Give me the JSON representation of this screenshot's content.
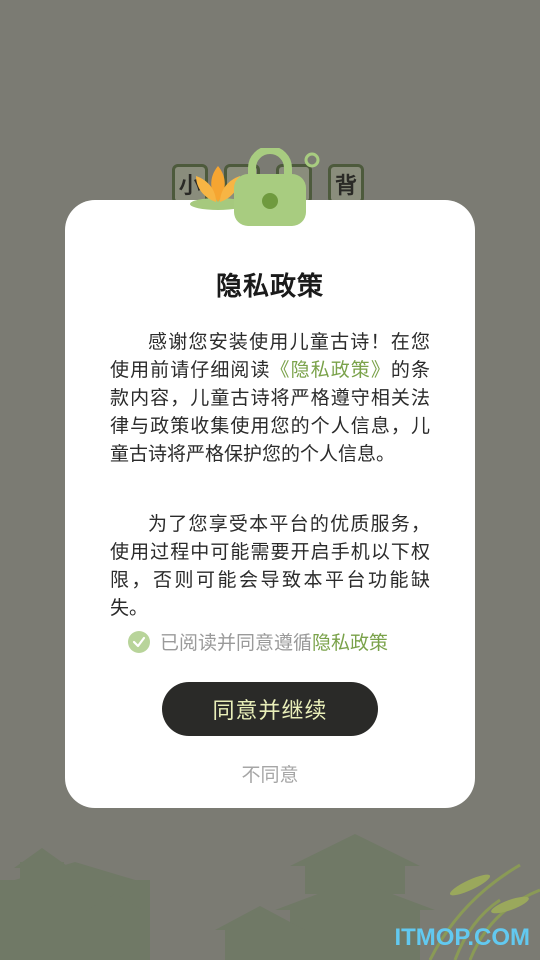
{
  "background": {
    "tiles": [
      "小",
      "背"
    ]
  },
  "dialog": {
    "title": "隐私政策",
    "paragraph1_before": "感谢您安装使用儿童古诗！在您使用前请仔细阅读",
    "paragraph1_link": "《隐私政策》",
    "paragraph1_after": "的条款内容，儿童古诗将严格遵守相关法律与政策收集使用您的个人信息，儿童古诗将严格保护您的个人信息。",
    "paragraph2": "为了您享受本平台的优质服务，使用过程中可能需要开启手机以下权限，否则可能会导致本平台功能缺失。",
    "consent_text": "已阅读并同意遵循",
    "consent_link": "隐私政策",
    "agree_label": "同意并继续",
    "disagree_label": "不同意"
  },
  "watermark": "ITMOP.COM",
  "colors": {
    "overlay_bg": "#7b7b73",
    "accent_green": "#7aa24a",
    "button_dark": "#2a2a28",
    "button_text": "#e9efb9"
  },
  "icons": {
    "lock": "lock-icon",
    "lotus": "lotus-icon",
    "check": "check-circle-icon"
  }
}
